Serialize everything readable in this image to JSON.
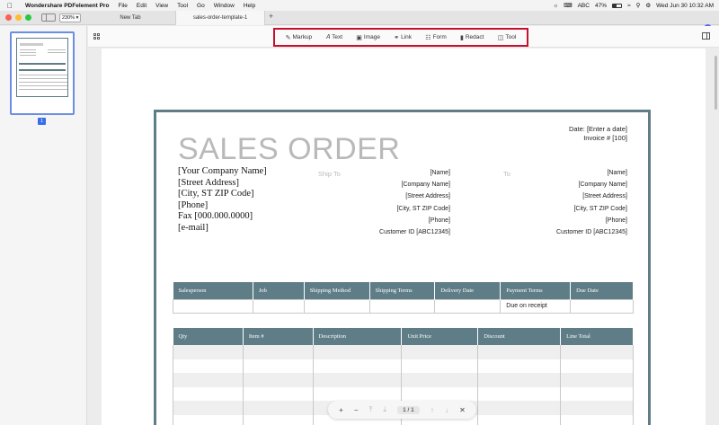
{
  "menubar": {
    "app_name": "Wondershare PDFelement Pro",
    "items": [
      "File",
      "Edit",
      "View",
      "Tool",
      "Go",
      "Window",
      "Help"
    ],
    "input_source": "ABC",
    "battery": "47%",
    "clock": "Wed Jun 30  10:32 AM"
  },
  "toolbar": {
    "zoom": "230%",
    "tabs": [
      "New Tab",
      "sales-order-template-1"
    ],
    "tools": [
      {
        "label": "Markup",
        "icon": "pen-icon"
      },
      {
        "label": "Text",
        "icon": "text-icon"
      },
      {
        "label": "Image",
        "icon": "image-icon"
      },
      {
        "label": "Link",
        "icon": "link-icon"
      },
      {
        "label": "Form",
        "icon": "form-icon"
      },
      {
        "label": "Redact",
        "icon": "redact-icon"
      },
      {
        "label": "Tool",
        "icon": "toolbox-icon"
      }
    ]
  },
  "thumbnails": {
    "page_label": "1"
  },
  "document": {
    "title": "SALES ORDER",
    "date": "Date: [Enter a date]",
    "invoice": "Invoice # [100]",
    "company_lines": [
      "[Your Company Name]",
      "[Street Address]",
      "[City, ST  ZIP Code]",
      "[Phone]",
      "Fax [000.000.0000]",
      "[e-mail]"
    ],
    "ship_to_label": "Ship To",
    "to_label": "To",
    "ship_to_lines": [
      "[Name]",
      "[Company Name]",
      "[Street Address]",
      "[City, ST  ZIP Code]",
      "[Phone]",
      "Customer ID [ABC12345]"
    ],
    "to_lines": [
      "[Name]",
      "[Company Name]",
      "[Street Address]",
      "[City, ST  ZIP Code]",
      "[Phone]",
      "Customer ID [ABC12345]"
    ],
    "table1": {
      "headers": [
        "Salesperson",
        "Job",
        "Shipping Method",
        "Shipping Terms",
        "Delivery Date",
        "Payment Terms",
        "Due Date"
      ],
      "row": [
        "",
        "",
        "",
        "",
        "",
        "Due on receipt",
        ""
      ]
    },
    "table2": {
      "headers": [
        "Qty",
        "Item #",
        "Description",
        "Unit Price",
        "Discount",
        "Line Total"
      ]
    }
  },
  "pagenav": {
    "zoom_in": "+",
    "zoom_out": "−",
    "page": "1  /  1"
  }
}
